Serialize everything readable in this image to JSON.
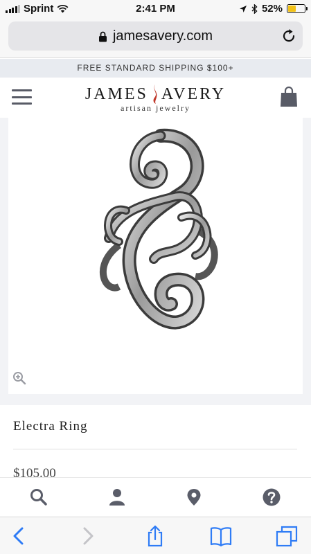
{
  "status_bar": {
    "carrier": "Sprint",
    "time": "2:41 PM",
    "battery_percent": "52%",
    "battery_level": 0.52,
    "icons": [
      "signal-bars-icon",
      "wifi-icon",
      "location-arrow-icon",
      "bluetooth-icon",
      "battery-icon"
    ]
  },
  "browser": {
    "url": "jamesavery.com",
    "icons": [
      "lock-icon",
      "reload-icon"
    ]
  },
  "promo": {
    "text": "FREE STANDARD SHIPPING $100+"
  },
  "header": {
    "logo_left": "JAMES",
    "logo_right": "AVERY",
    "logo_tagline": "artisan jewelry",
    "icons": [
      "hamburger-menu-icon",
      "flame-logo-icon",
      "shopping-bag-icon"
    ]
  },
  "product": {
    "name": "Electra Ring",
    "price": "$105.00",
    "image_icon": "ring-image",
    "zoom_icon": "zoom-in-icon"
  },
  "site_nav": {
    "icons": [
      "search-icon",
      "account-icon",
      "store-locator-icon",
      "help-icon"
    ]
  },
  "safari_toolbar": {
    "icons": [
      "back-icon",
      "forward-icon",
      "share-icon",
      "bookmarks-icon",
      "tabs-icon"
    ]
  },
  "colors": {
    "promo_bg": "#e8ebf0",
    "ios_blue": "#2f7cf6",
    "nav_icon": "#5a5d69",
    "battery_fill": "#f2c218"
  }
}
